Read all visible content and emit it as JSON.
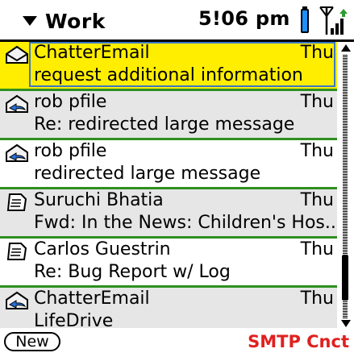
{
  "header": {
    "folder": "Work",
    "time": "5!06 pm"
  },
  "messages": [
    {
      "sender": "ChatterEmail",
      "date": "Thu",
      "subject": "request additional information",
      "icon": "envelope-read-icon",
      "state": "selected"
    },
    {
      "sender": "rob pfile",
      "date": "Thu",
      "subject": "Re: redirected large message",
      "icon": "envelope-reply-icon",
      "state": "normal"
    },
    {
      "sender": "rob pfile",
      "date": "Thu",
      "subject": "redirected large message",
      "icon": "envelope-reply-icon",
      "state": "normal"
    },
    {
      "sender": "Suruchi Bhatia",
      "date": "Thu",
      "subject": "Fwd: In the News: Children's Hos...",
      "icon": "document-icon",
      "state": "normal"
    },
    {
      "sender": "Carlos Guestrin",
      "date": "Thu",
      "subject": "Re: Bug Report w/ Log",
      "icon": "document-icon",
      "state": "normal"
    },
    {
      "sender": "ChatterEmail",
      "date": "Thu",
      "subject": "LifeDrive",
      "icon": "envelope-reply-icon",
      "state": "normal"
    }
  ],
  "footer": {
    "new_label": "New",
    "status": "SMTP Cnct"
  },
  "colors": {
    "selection": "#ffee00",
    "divider": "#2f8f1f",
    "status": "#e0201f"
  }
}
